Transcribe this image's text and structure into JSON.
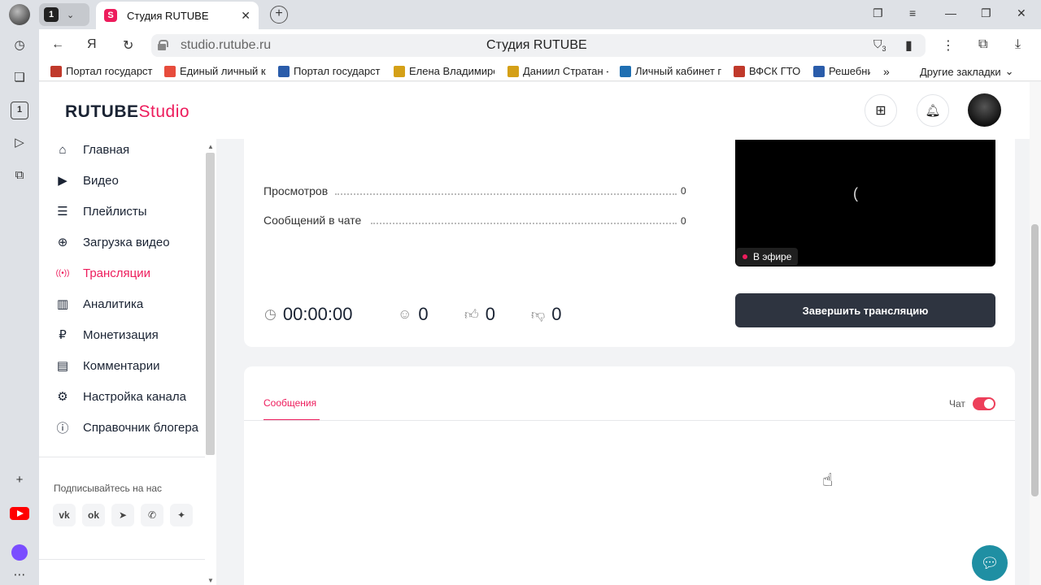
{
  "browser": {
    "tab_count": "1",
    "tab_title": "Студия RUTUBE",
    "url": "studio.rutube.ru",
    "page_title": "Студия RUTUBE",
    "shield_count": "3",
    "bookmarks": [
      {
        "label": "Портал государст",
        "color": "#c0392b"
      },
      {
        "label": "Единый личный к",
        "color": "#e74c3c"
      },
      {
        "label": "Портал государст",
        "color": "#2a5caa"
      },
      {
        "label": "Елена Владимиро",
        "color": "#d4a017"
      },
      {
        "label": "Даниил Стратан -",
        "color": "#d4a017"
      },
      {
        "label": "Личный кабинет г",
        "color": "#1f6fb2"
      },
      {
        "label": "ВФСК ГТО",
        "color": "#c0392b"
      },
      {
        "label": "Решебни",
        "color": "#2a5caa"
      }
    ],
    "other_bookmarks": "Другие закладки"
  },
  "studio": {
    "logo_main": "RUTUBE",
    "logo_studio": "Studio",
    "nav": [
      {
        "label": "Главная",
        "icon": "home-icon"
      },
      {
        "label": "Видео",
        "icon": "video-icon"
      },
      {
        "label": "Плейлисты",
        "icon": "playlist-icon"
      },
      {
        "label": "Загрузка видео",
        "icon": "upload-icon"
      },
      {
        "label": "Трансляции",
        "icon": "broadcast-icon"
      },
      {
        "label": "Аналитика",
        "icon": "analytics-icon"
      },
      {
        "label": "Монетизация",
        "icon": "ruble-icon"
      },
      {
        "label": "Комментарии",
        "icon": "comment-icon"
      },
      {
        "label": "Настройка канала",
        "icon": "gear-icon"
      },
      {
        "label": "Справочник блогера",
        "icon": "info-icon"
      }
    ],
    "follow_label": "Подписывайтесь на нас"
  },
  "stream": {
    "views_label": "Просмотров",
    "views_value": "0",
    "chat_messages_label": "Сообщений в чате",
    "chat_messages_value": "0",
    "live_badge": "В эфире",
    "duration": "00:00:00",
    "viewers": "0",
    "likes": "0",
    "dislikes": "0",
    "end_button": "Завершить трансляцию"
  },
  "messages": {
    "tab_label": "Сообщения",
    "chat_toggle_label": "Чат",
    "chat_enabled": true
  }
}
